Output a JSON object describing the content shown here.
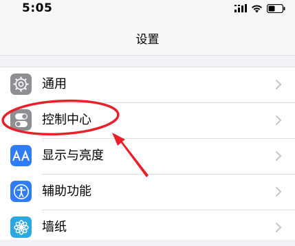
{
  "status_bar": {
    "time": "5:05",
    "icons": [
      "cellular-signal-icon",
      "wifi-icon",
      "battery-icon"
    ]
  },
  "nav": {
    "title": "设置"
  },
  "settings": {
    "items": [
      {
        "label": "通用",
        "icon": "gear-icon",
        "icon_color": "#8e8e93"
      },
      {
        "label": "控制中心",
        "icon": "toggles-icon",
        "icon_color": "#8e8e93"
      },
      {
        "label": "显示与亮度",
        "icon": "text-size-icon",
        "icon_color": "#2f7cf6"
      },
      {
        "label": "辅助功能",
        "icon": "accessibility-icon",
        "icon_color": "#2f7cf6"
      },
      {
        "label": "墙纸",
        "icon": "wallpaper-flower-icon",
        "icon_color": "#2aa9e0"
      }
    ]
  },
  "annotation": {
    "color": "#e8202a",
    "target": "控制中心"
  }
}
